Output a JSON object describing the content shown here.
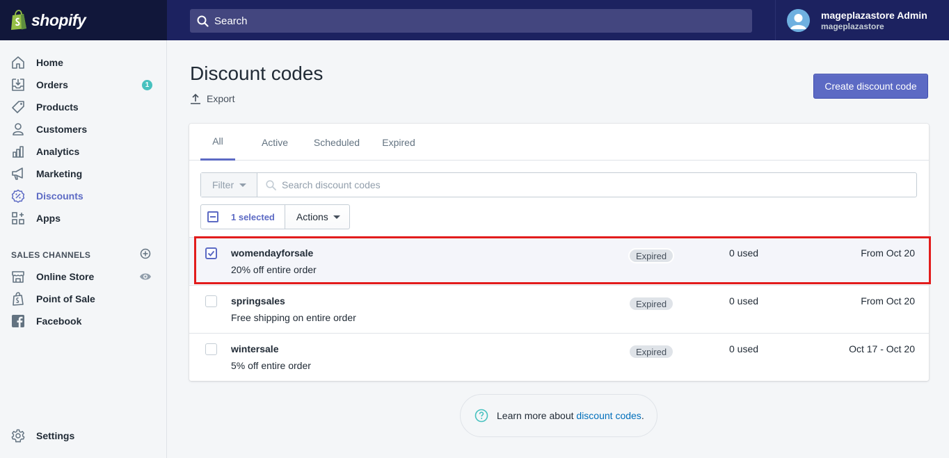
{
  "brand": {
    "name": "shopify",
    "accent": "#5c6ac4",
    "topbar_color": "#1c2260"
  },
  "search": {
    "placeholder": "Search"
  },
  "user": {
    "name": "mageplazastore Admin",
    "store": "mageplazastore"
  },
  "sidebar": {
    "items": [
      {
        "label": "Home",
        "icon": "home-icon"
      },
      {
        "label": "Orders",
        "icon": "orders-icon",
        "badge": "1"
      },
      {
        "label": "Products",
        "icon": "tag-icon"
      },
      {
        "label": "Customers",
        "icon": "person-icon"
      },
      {
        "label": "Analytics",
        "icon": "bar-chart-icon"
      },
      {
        "label": "Marketing",
        "icon": "megaphone-icon"
      },
      {
        "label": "Discounts",
        "icon": "discount-icon",
        "active": true
      },
      {
        "label": "Apps",
        "icon": "apps-icon"
      }
    ],
    "channels_header": "SALES CHANNELS",
    "channels": [
      {
        "label": "Online Store",
        "icon": "store-icon"
      },
      {
        "label": "Point of Sale",
        "icon": "shopify-bag-icon"
      },
      {
        "label": "Facebook",
        "icon": "facebook-icon"
      }
    ],
    "settings_label": "Settings"
  },
  "page": {
    "title": "Discount codes",
    "export_label": "Export",
    "create_button": "Create discount code"
  },
  "tabs": [
    "All",
    "Active",
    "Scheduled",
    "Expired"
  ],
  "filter": {
    "button": "Filter",
    "search_placeholder": "Search discount codes"
  },
  "bulk": {
    "selected_label": "1 selected",
    "actions_label": "Actions"
  },
  "discounts": [
    {
      "code": "womendayforsale",
      "description": "20% off entire order",
      "status": "Expired",
      "used": "0 used",
      "dates": "From Oct 20",
      "checked": true
    },
    {
      "code": "springsales",
      "description": "Free shipping on entire order",
      "status": "Expired",
      "used": "0 used",
      "dates": "From Oct 20",
      "checked": false
    },
    {
      "code": "wintersale",
      "description": "5% off entire order",
      "status": "Expired",
      "used": "0 used",
      "dates": "Oct 17 - Oct 20",
      "checked": false
    }
  ],
  "learn_more": {
    "prefix": "Learn more about ",
    "link": "discount codes",
    "suffix": "."
  }
}
